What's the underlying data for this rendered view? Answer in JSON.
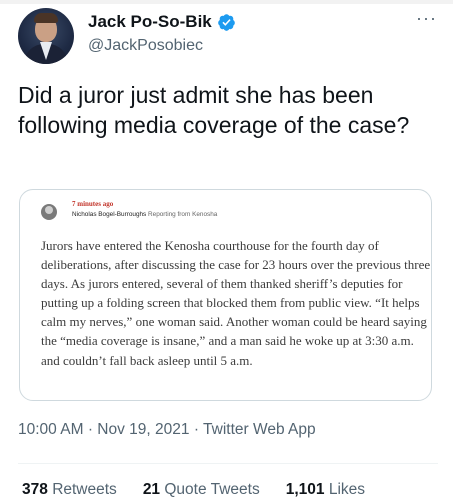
{
  "author": {
    "display_name": "Jack Po-So-Bik",
    "handle": "@JackPosobiec",
    "verified": true,
    "more_icon": "more-dots-icon"
  },
  "tweet": {
    "text": "Did a juror just admit she has been following media coverage of the case?"
  },
  "quoted_image": {
    "time_ago": "7 minutes ago",
    "reporter_name": "Nicholas Bogel-Burroughs",
    "reporter_location": "Reporting from Kenosha",
    "body": "Jurors have entered the Kenosha courthouse for the fourth day of deliberations, after discussing the case for 23 hours over the previous three days. As jurors entered, several of them thanked sheriff’s deputies for putting up a folding screen that blocked them from public view. “It helps calm my nerves,” one woman said. Another woman could be heard saying the “media coverage is insane,” and a man said he woke up at 3:30 a.m. and couldn’t fall back asleep until 5 a.m."
  },
  "meta": {
    "time": "10:00 AM",
    "date": "Nov 19, 2021",
    "app": "Twitter Web App",
    "separator": "·"
  },
  "stats": {
    "retweets_count": "378",
    "retweets_label": "Retweets",
    "quotes_count": "21",
    "quotes_label": "Quote Tweets",
    "likes_count": "1,101",
    "likes_label": "Likes"
  },
  "colors": {
    "verified_badge": "#1d9bf0",
    "secondary_text": "#536471",
    "time_ago_red": "#c2342a"
  }
}
